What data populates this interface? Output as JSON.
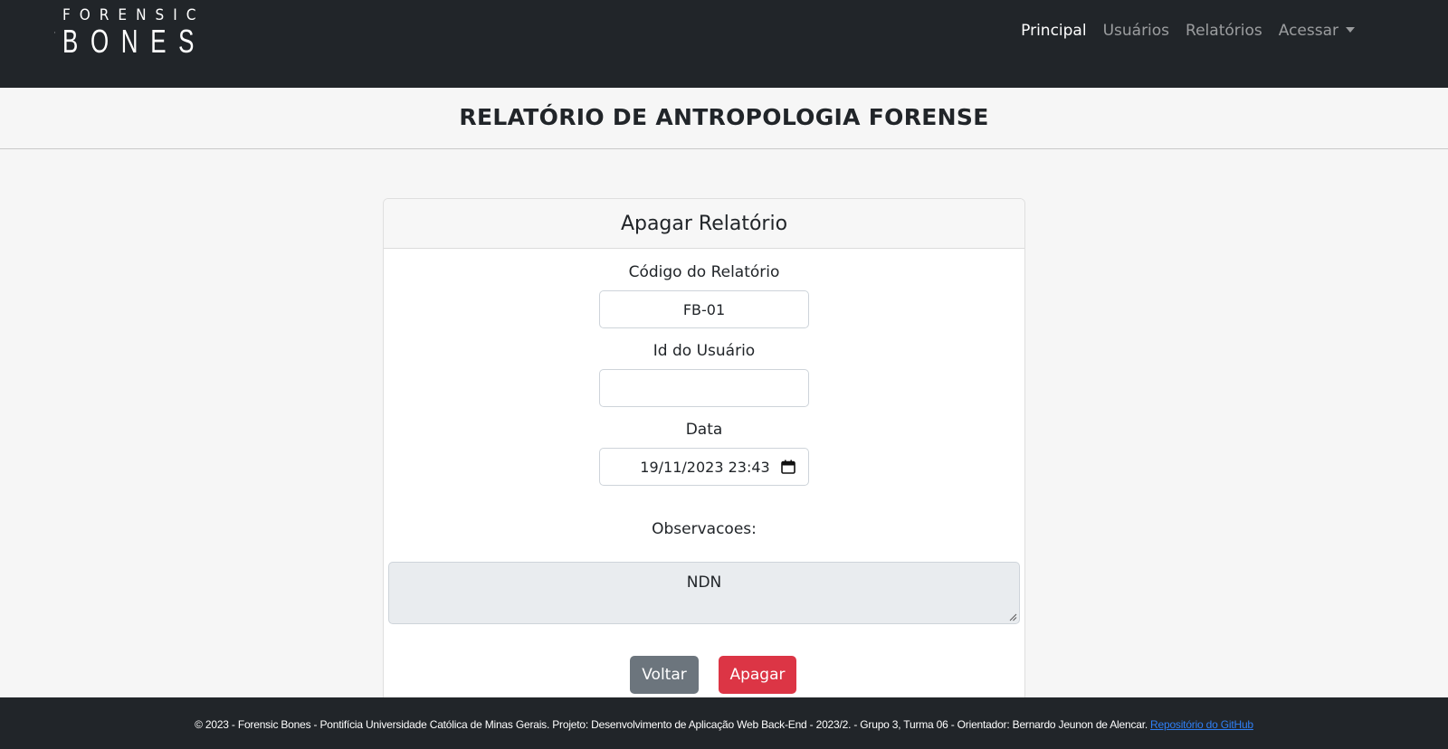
{
  "nav": {
    "logo_top": "FORENSIC",
    "logo_bottom": "BONES",
    "links": [
      {
        "label": "Principal"
      },
      {
        "label": "Usuários"
      },
      {
        "label": "Relatórios"
      },
      {
        "label": "Acessar"
      }
    ]
  },
  "page": {
    "title": "RELATÓRIO DE ANTROPOLOGIA FORENSE"
  },
  "card": {
    "title": "Apagar Relatório",
    "codigo_label": "Código do Relatório",
    "codigo_value": "FB-01",
    "usuario_label": "Id do Usuário",
    "usuario_value": "",
    "data_label": "Data",
    "data_value": "19/11/2023 23:43",
    "obs_label": "Observacoes:",
    "obs_value": "NDN",
    "back_label": "Voltar",
    "delete_label": "Apagar"
  },
  "footer": {
    "text": "© 2023 - Forensic Bones - Pontifícia Universidade Católica de Minas Gerais. Projeto: Desenvolvimento de Aplicação Web Back-End - 2023/2. - Grupo 3, Turma 06 - Orientador: Bernardo Jeunon de Alencar.",
    "link_label": "Repositório do GitHub"
  },
  "colors": {
    "navbar_bg": "#212529",
    "danger": "#dc3545",
    "secondary": "#6c757d",
    "link": "#2f7ff5"
  },
  "icons": {
    "logo": "skull-icon",
    "date": "calendar-icon",
    "dropdown": "caret-down-icon"
  }
}
